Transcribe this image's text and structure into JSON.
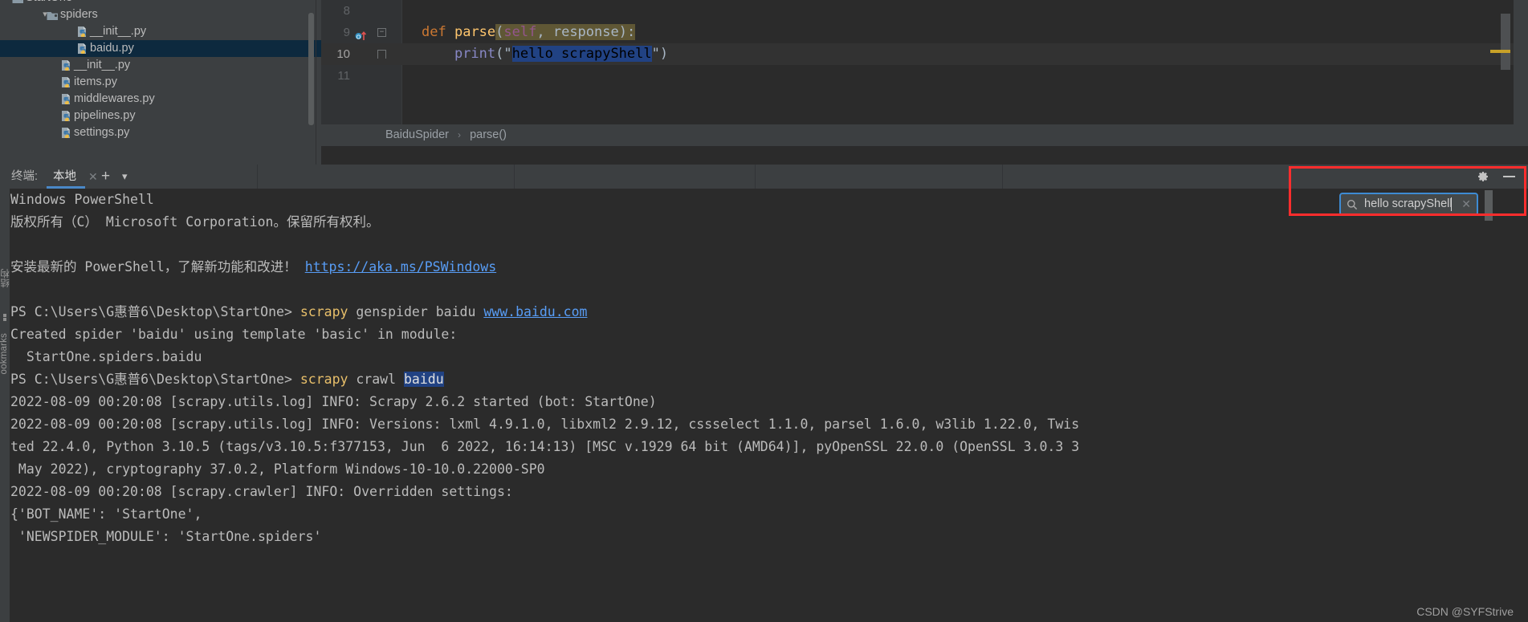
{
  "project_tree": {
    "items": [
      {
        "label": "StartOne",
        "indent": 32,
        "icon": "folder-icon",
        "expanded": true,
        "chevron": true,
        "selected": false,
        "clipped": true
      },
      {
        "label": "spiders",
        "indent": 75,
        "icon": "folder-icon",
        "expanded": true,
        "chevron": true,
        "selected": false,
        "clipped": false
      },
      {
        "label": "__init__.py",
        "indent": 112,
        "icon": "python-file-icon",
        "chevron": false,
        "selected": false,
        "clipped": false
      },
      {
        "label": "baidu.py",
        "indent": 112,
        "icon": "python-file-icon",
        "chevron": false,
        "selected": true,
        "clipped": false
      },
      {
        "label": "__init__.py",
        "indent": 92,
        "icon": "python-file-icon",
        "chevron": false,
        "selected": false,
        "clipped": false
      },
      {
        "label": "items.py",
        "indent": 92,
        "icon": "python-file-icon",
        "chevron": false,
        "selected": false,
        "clipped": false
      },
      {
        "label": "middlewares.py",
        "indent": 92,
        "icon": "python-file-icon",
        "chevron": false,
        "selected": false,
        "clipped": false
      },
      {
        "label": "pipelines.py",
        "indent": 92,
        "icon": "python-file-icon",
        "chevron": false,
        "selected": false,
        "clipped": false
      },
      {
        "label": "settings.py",
        "indent": 92,
        "icon": "python-file-icon",
        "chevron": false,
        "selected": false,
        "clipped": false
      }
    ]
  },
  "editor": {
    "lines": [
      {
        "number": "8",
        "highlight": false,
        "gutter": []
      },
      {
        "number": "9",
        "highlight": false,
        "gutter": [
          "override-marker",
          "fold-collapse"
        ]
      },
      {
        "number": "10",
        "highlight": true,
        "gutter": [
          "fold-end"
        ]
      },
      {
        "number": "11",
        "highlight": false,
        "gutter": []
      }
    ],
    "line9": {
      "kw_def": "def",
      "fn_name": "parse",
      "open_paren": "(",
      "self": "self",
      "comma": ", ",
      "param": "response",
      "close": "):"
    },
    "line10": {
      "fn": "print",
      "open": "(\"",
      "highlighted_text": "hello scrapyShell",
      "close": "\")"
    }
  },
  "breadcrumb": {
    "class_name": "BaiduSpider",
    "separator": "›",
    "method_name": "parse()"
  },
  "terminal_bar": {
    "label": "终端:",
    "active_tab": "本地",
    "close_glyph": "✕",
    "plus_glyph": "+",
    "chevron_glyph": "▾",
    "gear_name": "settings-gear-icon",
    "minimize_name": "minimize-icon"
  },
  "side_strip": {
    "bookmarks_label": "ookmarks",
    "structure_label": "结构"
  },
  "search": {
    "value": "hello scrapyShell",
    "icon": "search-icon",
    "close_glyph": "✕"
  },
  "terminal": {
    "lines": [
      {
        "segments": [
          {
            "t": "Windows PowerShell",
            "c": "plain"
          }
        ]
      },
      {
        "segments": [
          {
            "t": "版权所有（C） Microsoft Corporation。保留所有权利。",
            "c": "plain"
          }
        ]
      },
      {
        "segments": [
          {
            "t": "",
            "c": "plain"
          }
        ]
      },
      {
        "segments": [
          {
            "t": "安装最新的 PowerShell，了解新功能和改进！ ",
            "c": "plain"
          },
          {
            "t": "https://aka.ms/PSWindows",
            "c": "link"
          }
        ]
      },
      {
        "segments": [
          {
            "t": "",
            "c": "plain"
          }
        ]
      },
      {
        "segments": [
          {
            "t": "PS C:\\Users\\G惠普6\\Desktop\\StartOne> ",
            "c": "plain"
          },
          {
            "t": "scrapy",
            "c": "yellow"
          },
          {
            "t": " genspider baidu ",
            "c": "plain"
          },
          {
            "t": "www.baidu.com",
            "c": "link"
          }
        ]
      },
      {
        "segments": [
          {
            "t": "Created spider 'baidu' using template 'basic' in module:",
            "c": "plain"
          }
        ]
      },
      {
        "segments": [
          {
            "t": "  StartOne.spiders.baidu",
            "c": "plain"
          }
        ]
      },
      {
        "segments": [
          {
            "t": "PS C:\\Users\\G惠普6\\Desktop\\StartOne> ",
            "c": "plain"
          },
          {
            "t": "scrapy",
            "c": "yellow"
          },
          {
            "t": " crawl ",
            "c": "plain"
          },
          {
            "t": "baidu",
            "c": "sel"
          }
        ]
      },
      {
        "segments": [
          {
            "t": "2022-08-09 00:20:08 [scrapy.utils.log] INFO: Scrapy 2.6.2 started (bot: StartOne)",
            "c": "plain"
          }
        ]
      },
      {
        "segments": [
          {
            "t": "2022-08-09 00:20:08 [scrapy.utils.log] INFO: Versions: lxml 4.9.1.0, libxml2 2.9.12, cssselect 1.1.0, parsel 1.6.0, w3lib 1.22.0, Twis",
            "c": "plain"
          }
        ]
      },
      {
        "segments": [
          {
            "t": "ted 22.4.0, Python 3.10.5 (tags/v3.10.5:f377153, Jun  6 2022, 16:14:13) [MSC v.1929 64 bit (AMD64)], pyOpenSSL 22.0.0 (OpenSSL 3.0.3 3",
            "c": "plain"
          }
        ]
      },
      {
        "segments": [
          {
            "t": " May 2022), cryptography 37.0.2, Platform Windows-10-10.0.22000-SP0",
            "c": "plain"
          }
        ]
      },
      {
        "segments": [
          {
            "t": "2022-08-09 00:20:08 [scrapy.crawler] INFO: Overridden settings:",
            "c": "plain"
          }
        ]
      },
      {
        "segments": [
          {
            "t": "{'BOT_NAME': 'StartOne',",
            "c": "plain"
          }
        ]
      },
      {
        "segments": [
          {
            "t": " 'NEWSPIDER_MODULE': 'StartOne.spiders'",
            "c": "plain"
          }
        ]
      }
    ]
  },
  "watermark": {
    "text": "CSDN @SYFStrive"
  },
  "colors": {
    "accent_blue": "#4a88c7",
    "selection_blue": "#214283",
    "annotation_red": "#ff2d2d",
    "keyword_orange": "#cc7832",
    "string_green": "#6a8759",
    "function_yellow": "#ffc66d"
  }
}
